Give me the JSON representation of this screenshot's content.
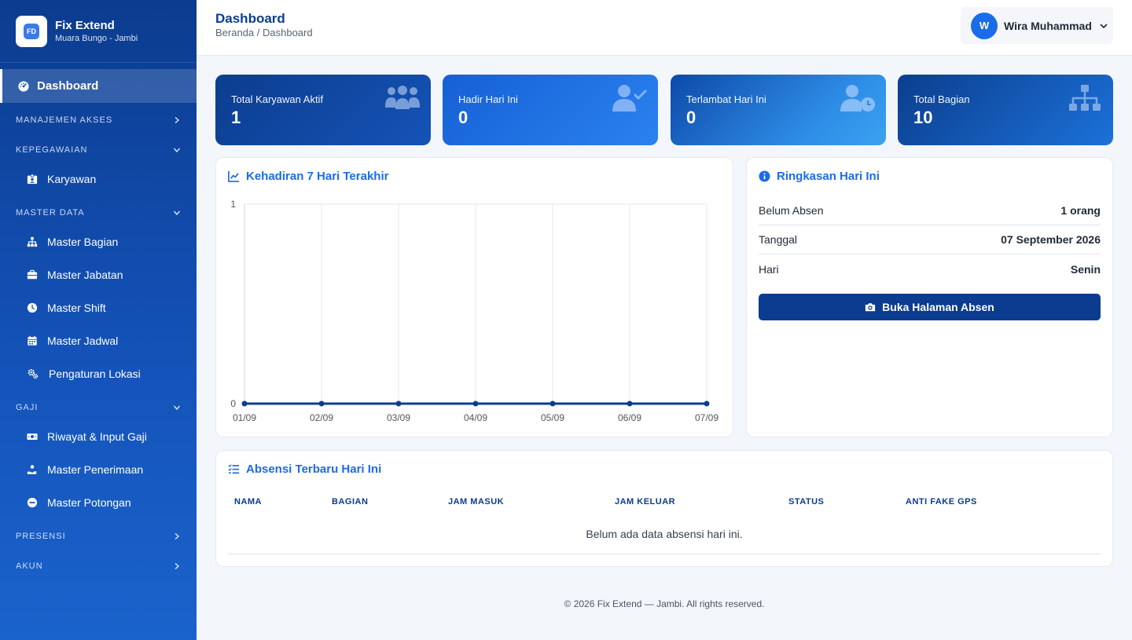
{
  "brand": {
    "name": "Fix Extend",
    "subtitle": "Muara Bungo - Jambi",
    "logo_text": "FD"
  },
  "sidebar": {
    "active": {
      "label": "Dashboard",
      "icon": "gauge-icon"
    },
    "sections": [
      {
        "label": "MANAJEMEN AKSES",
        "state": "collapsed",
        "items": []
      },
      {
        "label": "KEPEGAWAIAN",
        "state": "expanded",
        "items": [
          {
            "label": "Karyawan",
            "icon": "id-badge-icon"
          }
        ]
      },
      {
        "label": "MASTER DATA",
        "state": "expanded",
        "items": [
          {
            "label": "Master Bagian",
            "icon": "sitemap-icon"
          },
          {
            "label": "Master Jabatan",
            "icon": "briefcase-icon"
          },
          {
            "label": "Master Shift",
            "icon": "clock-icon"
          },
          {
            "label": "Master Jadwal",
            "icon": "calendar-icon"
          },
          {
            "label": "Pengaturan Lokasi",
            "icon": "cogs-icon"
          }
        ]
      },
      {
        "label": "GAJI",
        "state": "expanded",
        "items": [
          {
            "label": "Riwayat & Input Gaji",
            "icon": "money-icon"
          },
          {
            "label": "Master Penerimaan",
            "icon": "hand-coin-icon"
          },
          {
            "label": "Master Potongan",
            "icon": "minus-circle-icon"
          }
        ]
      },
      {
        "label": "PRESENSI",
        "state": "collapsed",
        "items": []
      },
      {
        "label": "AKUN",
        "state": "collapsed",
        "items": []
      }
    ]
  },
  "header": {
    "title": "Dashboard",
    "breadcrumb": "Beranda / Dashboard"
  },
  "user": {
    "initial": "W",
    "name": "Wira Muhammad"
  },
  "stats": [
    {
      "label": "Total Karyawan Aktif",
      "value": "1",
      "icon": "users-icon"
    },
    {
      "label": "Hadir Hari Ini",
      "value": "0",
      "icon": "user-check-icon"
    },
    {
      "label": "Terlambat Hari Ini",
      "value": "0",
      "icon": "user-clock-icon"
    },
    {
      "label": "Total Bagian",
      "value": "10",
      "icon": "sitemap-icon"
    }
  ],
  "chart_card": {
    "title": "Kehadiran 7 Hari Terakhir"
  },
  "chart_data": {
    "type": "line",
    "categories": [
      "01/09",
      "02/09",
      "03/09",
      "04/09",
      "05/09",
      "06/09",
      "07/09"
    ],
    "series": [
      {
        "values": [
          0,
          0,
          0,
          0,
          0,
          0,
          0
        ],
        "color": "#0b3c8f"
      }
    ],
    "y_ticks": [
      "0",
      "1"
    ],
    "ylim": [
      0,
      1
    ],
    "grid": "vertical"
  },
  "summary": {
    "title": "Ringkasan Hari Ini",
    "rows": [
      {
        "label": "Belum Absen",
        "value": "1 orang"
      },
      {
        "label": "Tanggal",
        "value": "07 September 2026"
      },
      {
        "label": "Hari",
        "value": "Senin"
      }
    ],
    "button_label": "Buka Halaman Absen"
  },
  "attendance": {
    "title": "Absensi Terbaru Hari Ini",
    "columns": [
      "NAMA",
      "BAGIAN",
      "JAM MASUK",
      "JAM KELUAR",
      "STATUS",
      "ANTI FAKE GPS"
    ],
    "empty_message": "Belum ada data absensi hari ini."
  },
  "footer": {
    "text": "© 2026 Fix Extend — Jambi. All rights reserved."
  },
  "colors": {
    "primary": "#0b3c8f",
    "accent": "#1a6ce8",
    "background": "#f3f6fa"
  }
}
